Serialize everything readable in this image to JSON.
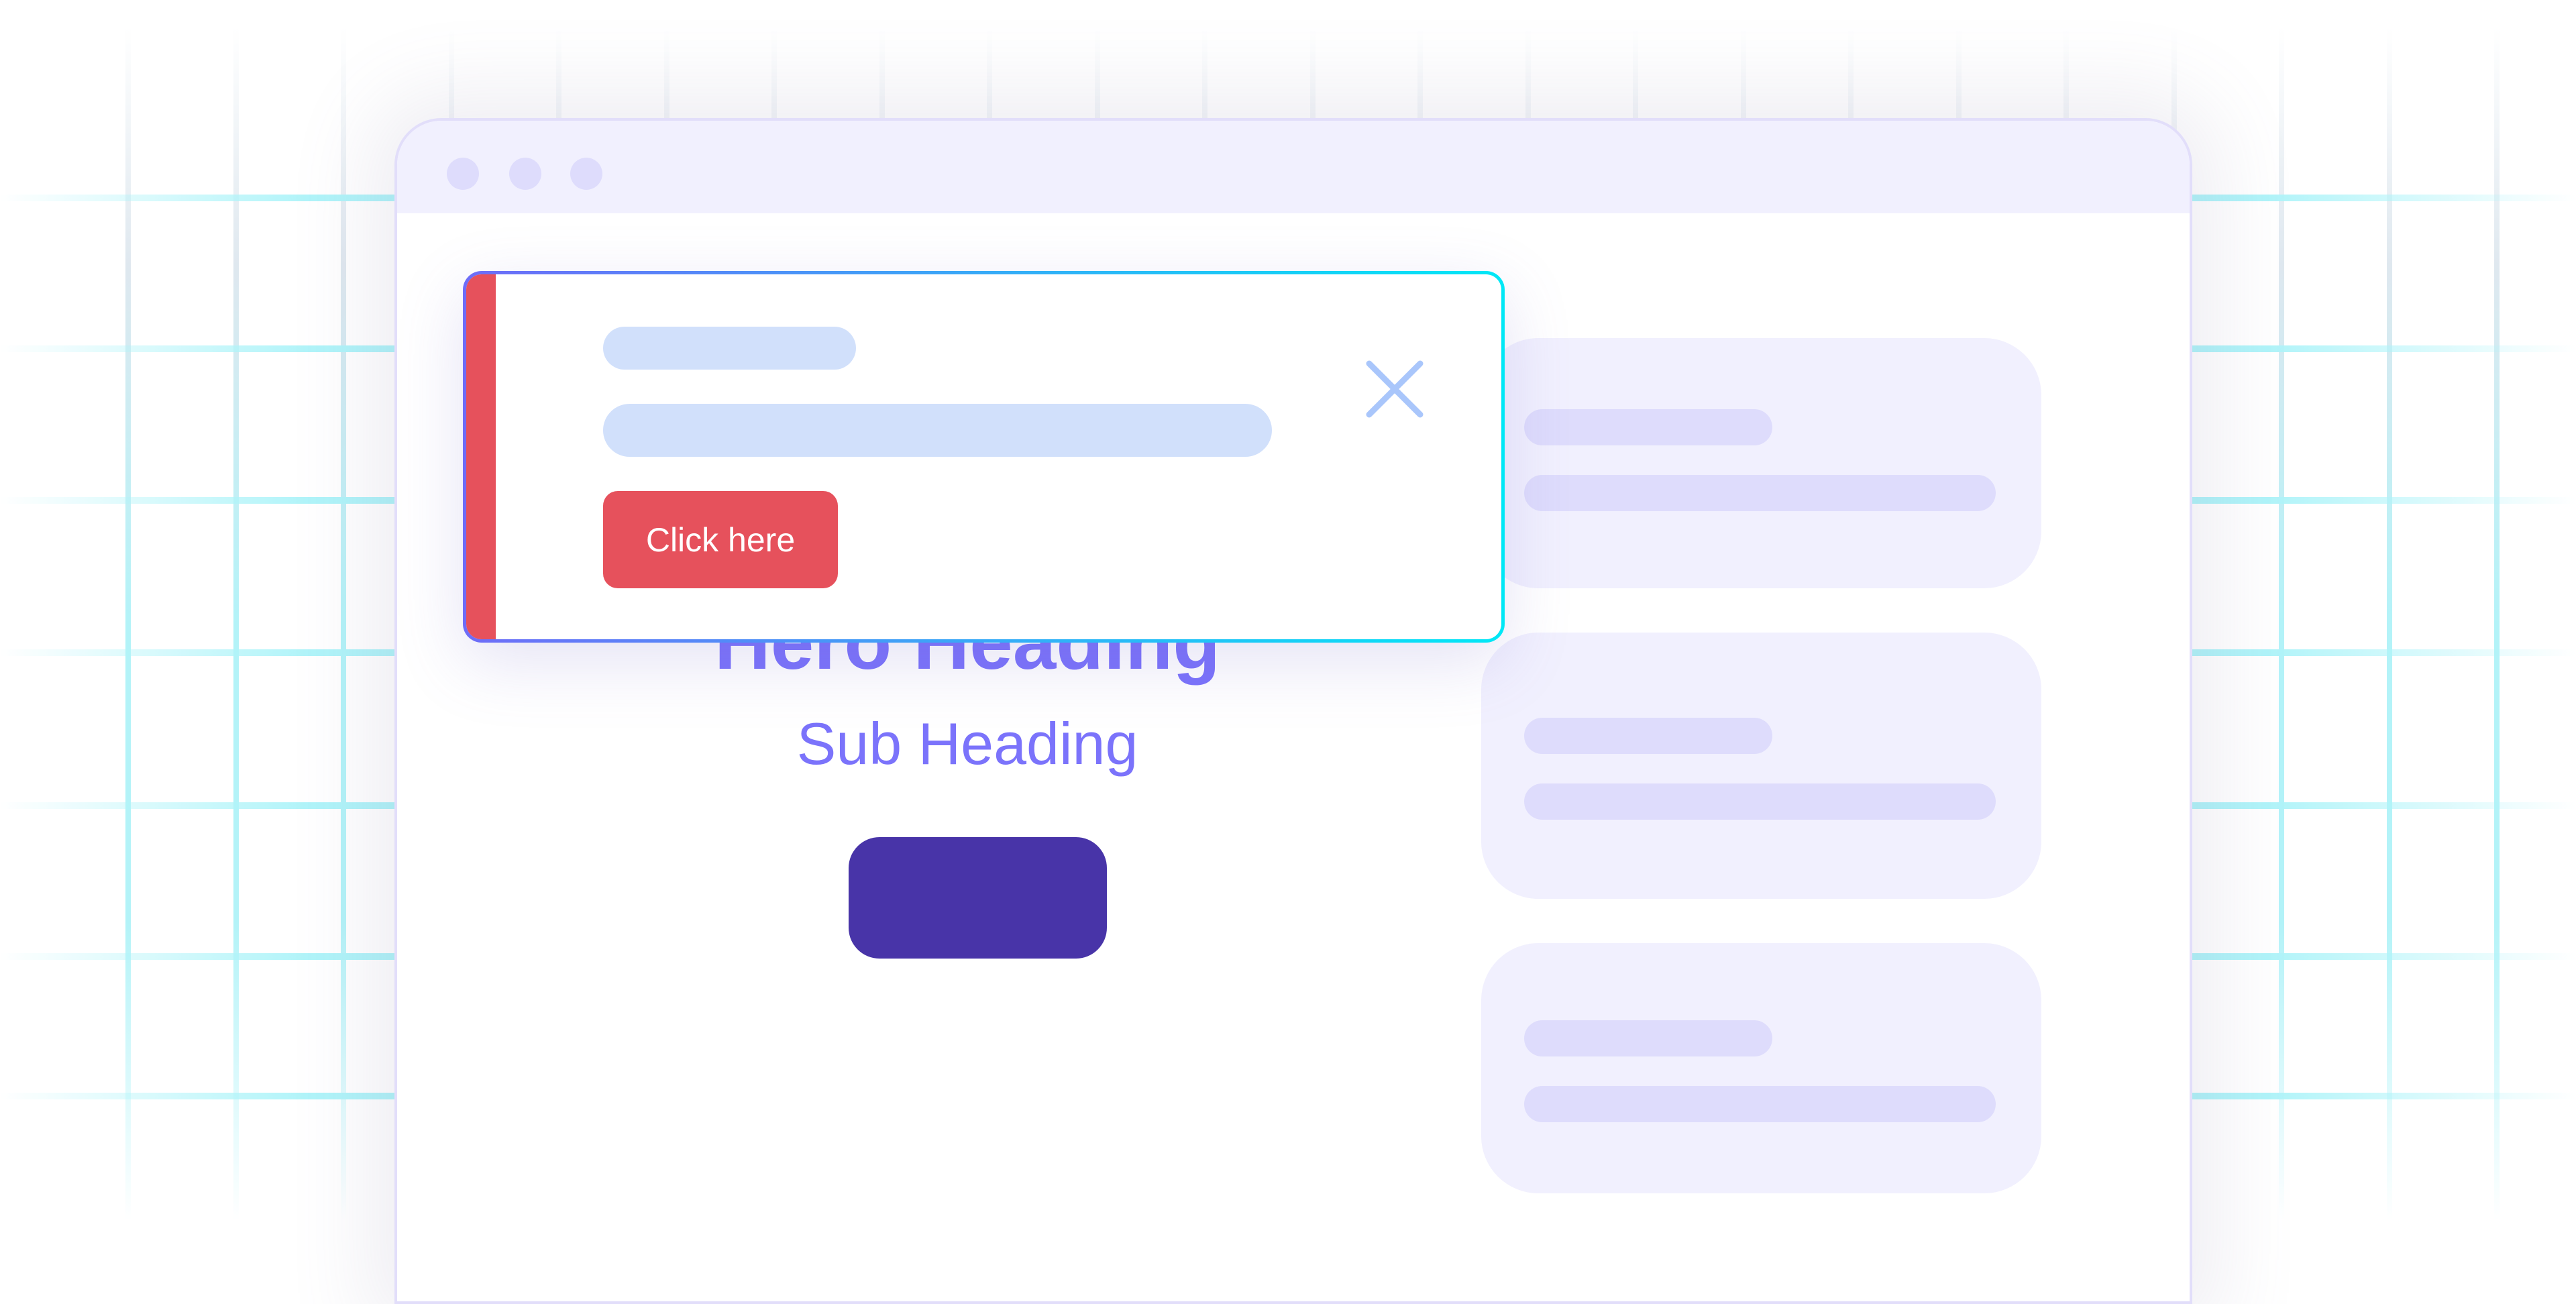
{
  "hero": {
    "heading": "Hero Heading",
    "subheading": "Sub Heading"
  },
  "toast": {
    "button_label": "Click here",
    "close_icon": "close-x-icon",
    "accent_color": "#e6515c"
  },
  "colors": {
    "primary": "#4834a8",
    "heading": "#7b73fb",
    "grid": "#b0f4f9"
  }
}
